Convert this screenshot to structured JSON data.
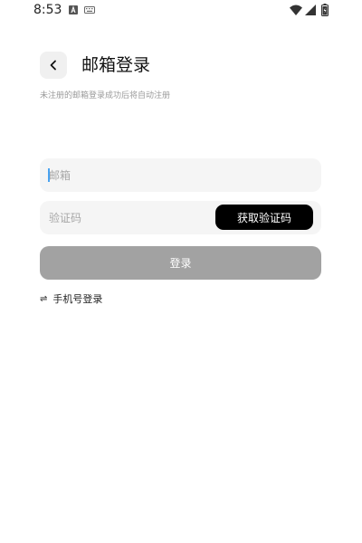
{
  "status_bar": {
    "time": "8:53",
    "icons": [
      "a-icon",
      "keyboard-icon",
      "wifi-icon",
      "signal-icon",
      "battery-icon"
    ]
  },
  "header": {
    "back_icon": "chevron-left-icon",
    "title": "邮箱登录",
    "subtitle": "未注册的邮箱登录成功后将自动注册"
  },
  "form": {
    "email_placeholder": "邮箱",
    "email_value": "",
    "code_placeholder": "验证码",
    "code_value": "",
    "get_code_label": "获取验证码",
    "login_label": "登录"
  },
  "footer": {
    "switch_icon": "swap-icon",
    "switch_label": "手机号登录"
  },
  "colors": {
    "input_bg": "#f5f5f5",
    "login_disabled_bg": "#a2a2a2",
    "get_code_bg": "#000000",
    "caret": "#4aa3f0"
  }
}
